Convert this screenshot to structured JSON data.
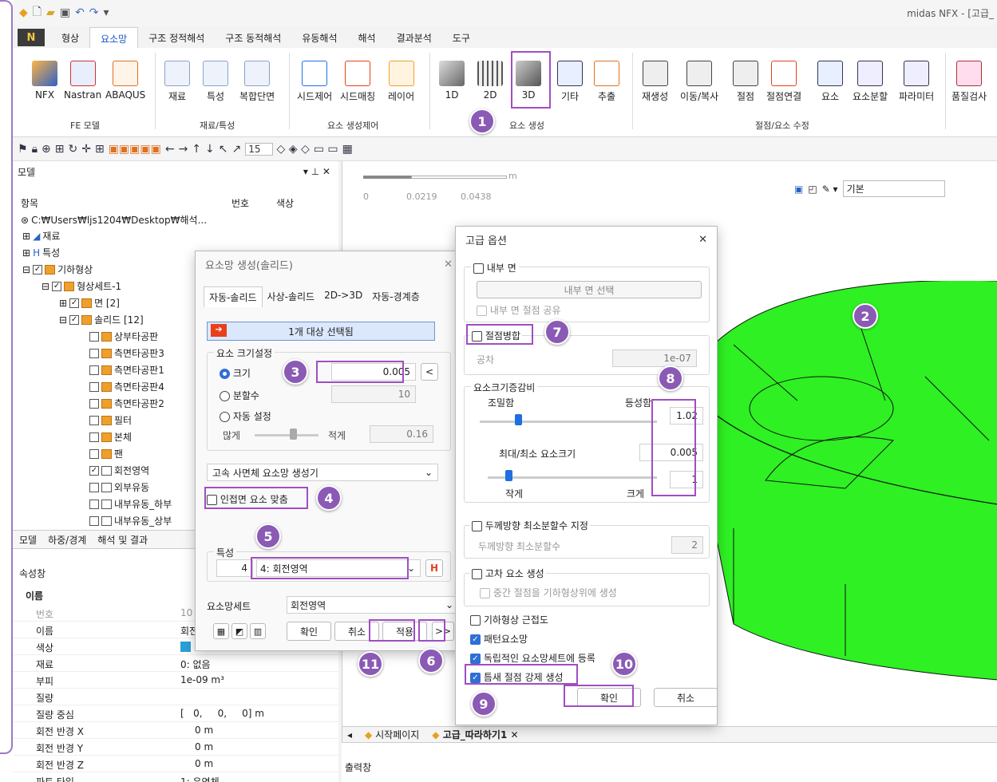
{
  "app": {
    "title": "midas NFX - [고급_"
  },
  "menu": {
    "file": "N",
    "tabs": [
      "형상",
      "요소망",
      "구조 정적해석",
      "구조 동적해석",
      "유동해석",
      "해석",
      "결과분석",
      "도구"
    ],
    "active_tab": "요소망"
  },
  "ribbon": {
    "fe_model": {
      "label": "FE 모델",
      "buttons": [
        "NFX",
        "Nastran",
        "ABAQUS"
      ]
    },
    "material": {
      "label": "재료/특성",
      "buttons": [
        "재료",
        "특성",
        "복합단면"
      ]
    },
    "seed": {
      "label": "요소 생성제어",
      "buttons": [
        "시드제어",
        "시드매칭",
        "레이어"
      ]
    },
    "mesh": {
      "label": "요소 생성",
      "buttons": [
        "1D",
        "2D",
        "3D",
        "기타",
        "추출"
      ]
    },
    "edit": {
      "label": "절점/요소 수정",
      "buttons": [
        "재생성",
        "이동/복사",
        "절점",
        "절점연결",
        "요소",
        "요소분할",
        "파라미터"
      ]
    },
    "check": {
      "buttons": [
        "품질검사"
      ]
    }
  },
  "toolbar": {
    "view_count": "15",
    "view_mode": "기본"
  },
  "model_panel": {
    "title": "모델",
    "col_item": "항목",
    "col_num": "번호",
    "col_color": "색상",
    "path": "C:₩Users₩ljs1204₩Desktop₩해석...",
    "tree": [
      "재료",
      "특성",
      "기하형상",
      "형상세트-1",
      "면 [2]",
      "솔리드 [12]",
      "상부타공판",
      "측면타공판3",
      "측면타공판1",
      "측면타공판4",
      "측면타공판2",
      "필터",
      "본체",
      "팬",
      "회전영역",
      "외부유동",
      "내부유동_하부",
      "내부유동_상부"
    ],
    "bottom_tabs": [
      "모델",
      "하중/경계",
      "해석 및 결과"
    ]
  },
  "properties": {
    "title": "속성창",
    "section": "이름",
    "rows": [
      {
        "k": "번호",
        "v": "10"
      },
      {
        "k": "이름",
        "v": "회전"
      },
      {
        "k": "색상",
        "v": ""
      },
      {
        "k": "재료",
        "v": "0: 없음"
      },
      {
        "k": "부피",
        "v": "1e-09 m³"
      },
      {
        "k": "질량",
        "v": ""
      },
      {
        "k": "질량 중심",
        "v": "[   0,     0,     0] m"
      },
      {
        "k": "회전 반경 X",
        "v": "0 m"
      },
      {
        "k": "회전 반경 Y",
        "v": "0 m"
      },
      {
        "k": "회전 반경 Z",
        "v": "0 m"
      },
      {
        "k": "파트 타입",
        "v": "1: 유연체"
      }
    ]
  },
  "viewport": {
    "scale_unit": "m",
    "scale_ticks": [
      "0",
      "0.0219",
      "0.0438"
    ],
    "tabs": [
      "시작페이지",
      "고급_따라하기1"
    ],
    "output": "출력창"
  },
  "mesh_dialog": {
    "title": "요소망 생성(솔리드)",
    "tabs": [
      "자동-솔리드",
      "사상-솔리드",
      "2D->3D",
      "자동-경계층"
    ],
    "select_text": "1개 대상 선택됨",
    "size_group": "요소 크기설정",
    "size_label": "크기",
    "size_value": "0.005",
    "div_label": "분할수",
    "div_value": "10",
    "auto_label": "자동 설정",
    "auto_fine": "많게",
    "auto_coarse": "적게",
    "auto_value": "0.16",
    "generator": "고속 사면체 요소망 생성기",
    "match_label": "인접면 요소 맞춤",
    "prop_group": "특성",
    "prop_id": "4",
    "prop_value": "4: 회전영역",
    "meshset_label": "요소망세트",
    "meshset_value": "회전영역",
    "ok": "확인",
    "cancel": "취소",
    "apply": "적용",
    "more": ">>"
  },
  "adv_dialog": {
    "title": "고급 옵션",
    "inner_face": "내부 면",
    "inner_face_select": "내부 면 선택",
    "inner_share": "내부 면 절점 공유",
    "merge_nodes": "절점병합",
    "tolerance_label": "공차",
    "tolerance_value": "1e-07",
    "growth_group": "요소크기증감비",
    "fine": "조밀함",
    "uniform": "등성함",
    "growth_value": "1.02",
    "maxmin_label": "최대/최소 요소크기",
    "max_value": "0.005",
    "small": "작게",
    "large": "크게",
    "min_value": "1",
    "thick_label": "두께방향 최소분할수 지정",
    "thick_sub": "두께방향 최소분할수",
    "thick_value": "2",
    "high_order": "고차 요소 생성",
    "mid_nodes": "중간 절점을 기하형상위에 생성",
    "geom_near": "기하형상 근접도",
    "pattern": "패턴요소망",
    "indep_set": "독립적인 요소망세트에 등록",
    "gap_nodes": "틈새 절점 강제 생성",
    "ok": "확인",
    "cancel": "취소"
  },
  "badges": [
    "1",
    "2",
    "3",
    "4",
    "5",
    "6",
    "7",
    "8",
    "9",
    "10",
    "11"
  ],
  "colors": {
    "accent": "#8a5ab5",
    "mesh_green": "#22e81a",
    "highlight": "#a04ec2"
  }
}
